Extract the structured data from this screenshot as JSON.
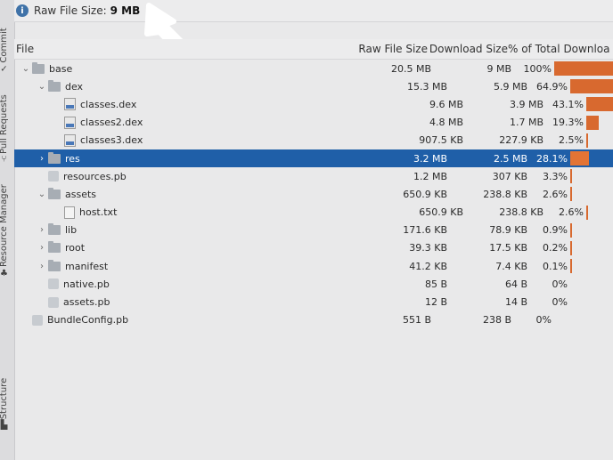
{
  "top": {
    "raw_label": "Raw File Size:",
    "raw_value": "9 MB"
  },
  "left_tabs": [
    "Commit",
    "Pull Requests",
    "Resource Manager",
    "Structure"
  ],
  "headers": {
    "file": "File",
    "raw": "Raw File Size",
    "download": "Download Size",
    "percent": "% of Total Downloa"
  },
  "rows": [
    {
      "indent": 0,
      "chev": "v",
      "icon": "folder",
      "name": "base",
      "raw": "20.5 MB",
      "dl": "9 MB",
      "pct": "100%",
      "bar": 100
    },
    {
      "indent": 1,
      "chev": "v",
      "icon": "folder",
      "name": "dex",
      "raw": "15.3 MB",
      "dl": "5.9 MB",
      "pct": "64.9%",
      "bar": 64.9
    },
    {
      "indent": 2,
      "chev": "",
      "icon": "dex",
      "name": "classes.dex",
      "raw": "9.6 MB",
      "dl": "3.9 MB",
      "pct": "43.1%",
      "bar": 43.1
    },
    {
      "indent": 2,
      "chev": "",
      "icon": "dex",
      "name": "classes2.dex",
      "raw": "4.8 MB",
      "dl": "1.7 MB",
      "pct": "19.3%",
      "bar": 19.3
    },
    {
      "indent": 2,
      "chev": "",
      "icon": "dex",
      "name": "classes3.dex",
      "raw": "907.5 KB",
      "dl": "227.9 KB",
      "pct": "2.5%",
      "bar": 2.5
    },
    {
      "indent": 1,
      "chev": ">",
      "icon": "folder",
      "name": "res",
      "raw": "3.2 MB",
      "dl": "2.5 MB",
      "pct": "28.1%",
      "bar": 28.1,
      "selected": true
    },
    {
      "indent": 1,
      "chev": "",
      "icon": "pb",
      "name": "resources.pb",
      "raw": "1.2 MB",
      "dl": "307 KB",
      "pct": "3.3%",
      "bar": 3.3
    },
    {
      "indent": 1,
      "chev": "v",
      "icon": "folder",
      "name": "assets",
      "raw": "650.9 KB",
      "dl": "238.8 KB",
      "pct": "2.6%",
      "bar": 2.6
    },
    {
      "indent": 2,
      "chev": "",
      "icon": "txt",
      "name": "host.txt",
      "raw": "650.9 KB",
      "dl": "238.8 KB",
      "pct": "2.6%",
      "bar": 2.6
    },
    {
      "indent": 1,
      "chev": ">",
      "icon": "folder",
      "name": "lib",
      "raw": "171.6 KB",
      "dl": "78.9 KB",
      "pct": "0.9%",
      "bar": 0.9
    },
    {
      "indent": 1,
      "chev": ">",
      "icon": "folder",
      "name": "root",
      "raw": "39.3 KB",
      "dl": "17.5 KB",
      "pct": "0.2%",
      "bar": 0.2
    },
    {
      "indent": 1,
      "chev": ">",
      "icon": "folder",
      "name": "manifest",
      "raw": "41.2 KB",
      "dl": "7.4 KB",
      "pct": "0.1%",
      "bar": 0.1
    },
    {
      "indent": 1,
      "chev": "",
      "icon": "pb",
      "name": "native.pb",
      "raw": "85 B",
      "dl": "64 B",
      "pct": "0%",
      "bar": 0
    },
    {
      "indent": 1,
      "chev": "",
      "icon": "pb",
      "name": "assets.pb",
      "raw": "12 B",
      "dl": "14 B",
      "pct": "0%",
      "bar": 0
    },
    {
      "indent": 0,
      "chev": "",
      "icon": "pb",
      "name": "BundleConfig.pb",
      "raw": "551 B",
      "dl": "238 B",
      "pct": "0%",
      "bar": 0
    }
  ]
}
